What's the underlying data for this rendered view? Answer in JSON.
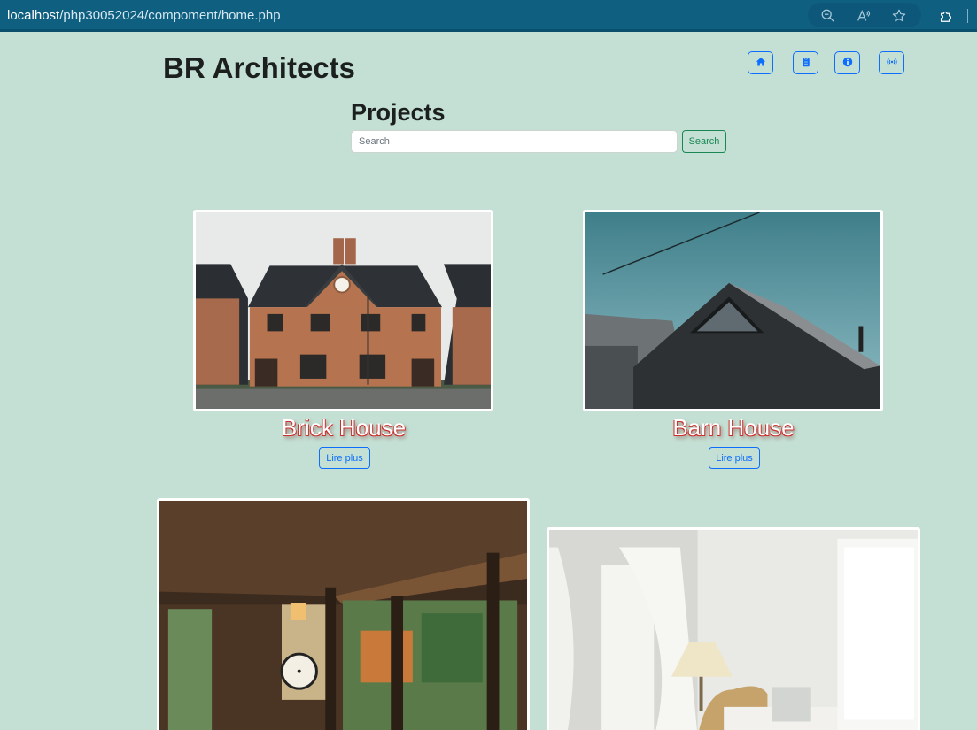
{
  "browser": {
    "url_host": "localhost",
    "url_path": "/php30052024/compoment/home.php",
    "icons": [
      "zoom-out-icon",
      "read-aloud-icon",
      "favorite-star-icon",
      "extensions-puzzle-icon"
    ]
  },
  "header": {
    "site_title": "BR Architects",
    "nav_icons": [
      "home-icon",
      "clipboard-icon",
      "info-icon",
      "broadcast-icon"
    ],
    "accent_color": "#0d6efd"
  },
  "projects": {
    "heading": "Projects",
    "search_placeholder": "Search",
    "search_button": "Search",
    "search_button_color": "#198754",
    "items": [
      {
        "title": "Brick House",
        "button": "Lire plus"
      },
      {
        "title": "Barn House",
        "button": "Lire plus"
      },
      {
        "title": "",
        "button": ""
      },
      {
        "title": "",
        "button": ""
      }
    ]
  },
  "colors": {
    "page_background": "#c4e0d4",
    "browser_bar": "#0f5f80"
  }
}
